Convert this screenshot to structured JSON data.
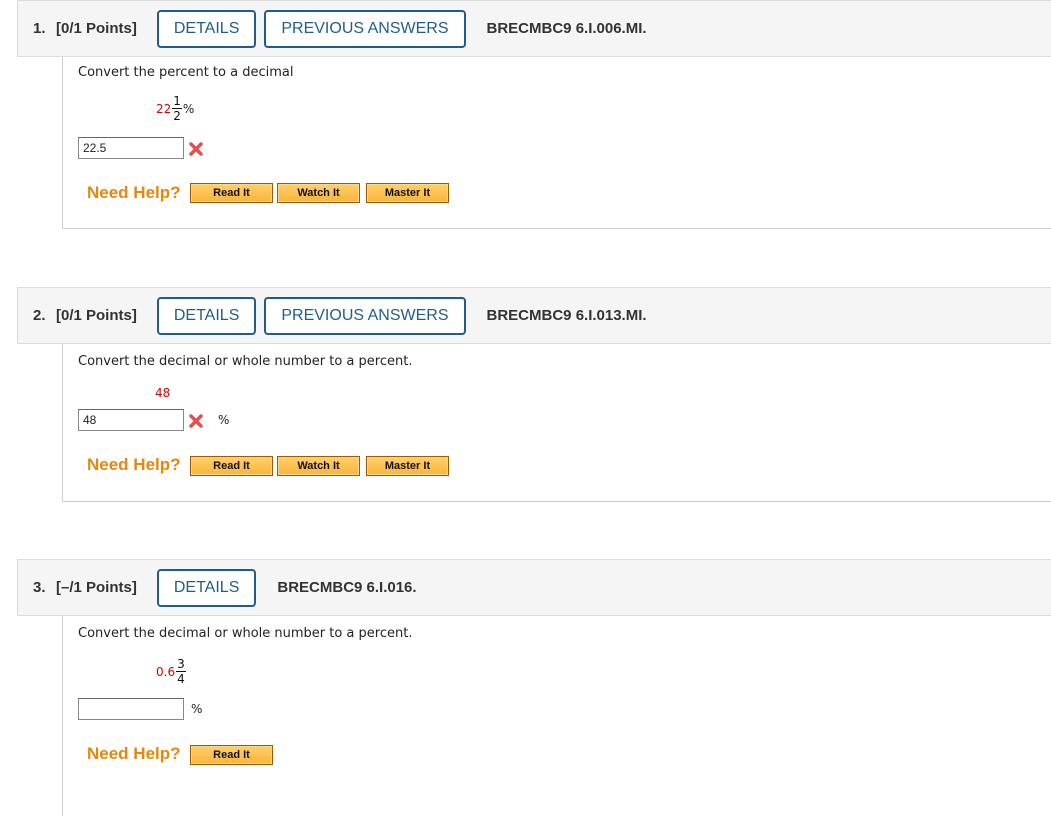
{
  "questions": [
    {
      "number": "1.",
      "points": "[0/1 Points]",
      "details_label": "DETAILS",
      "previous_answers_label": "PREVIOUS ANSWERS",
      "code": "BRECMBC9 6.I.006.MI.",
      "prompt": "Convert the percent to a decimal",
      "expression": {
        "whole": "22",
        "numerator": "1",
        "denominator": "2",
        "suffix": "%"
      },
      "answer_value": "22.5",
      "answer_status": "incorrect",
      "need_help_label": "Need Help?",
      "help_buttons": [
        "Read It",
        "Watch It",
        "Master It"
      ]
    },
    {
      "number": "2.",
      "points": "[0/1 Points]",
      "details_label": "DETAILS",
      "previous_answers_label": "PREVIOUS ANSWERS",
      "code": "BRECMBC9 6.I.013.MI.",
      "prompt": "Convert the decimal or whole number to a percent.",
      "expression": {
        "value": "48"
      },
      "answer_value": "48",
      "answer_status": "incorrect",
      "unit": "%",
      "need_help_label": "Need Help?",
      "help_buttons": [
        "Read It",
        "Watch It",
        "Master It"
      ]
    },
    {
      "number": "3.",
      "points": "[–/1 Points]",
      "details_label": "DETAILS",
      "code": "BRECMBC9 6.I.016.",
      "prompt": "Convert the decimal or whole number to a percent.",
      "expression": {
        "whole": "0.6",
        "numerator": "3",
        "denominator": "4"
      },
      "answer_value": "",
      "unit": "%",
      "need_help_label": "Need Help?",
      "help_buttons": [
        "Read It"
      ]
    }
  ],
  "colors": {
    "header_bg": "#f5f5f5",
    "button_blue": "#1f5d8c",
    "need_help_orange": "#e8870c",
    "help_button_fill": "#fbb43a",
    "incorrect_red": "#e00000"
  }
}
